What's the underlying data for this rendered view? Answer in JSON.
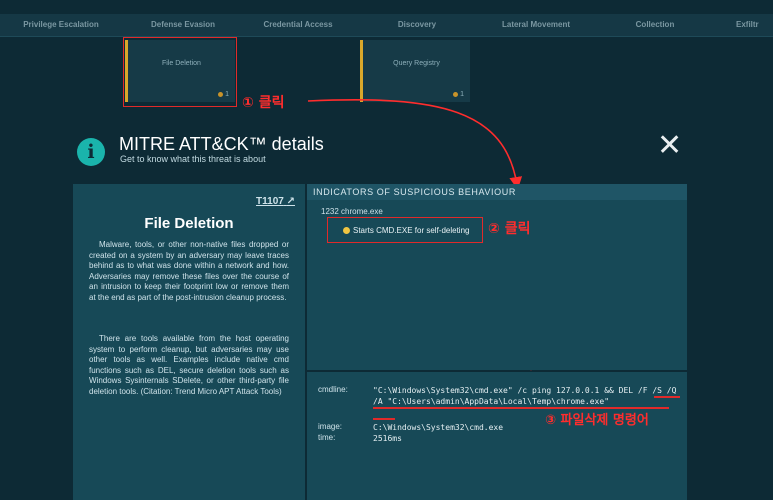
{
  "tactics": [
    "Privilege Escalation",
    "Defense Evasion",
    "Credential Access",
    "Discovery",
    "Lateral Movement",
    "Collection",
    "Exfiltr"
  ],
  "cards": [
    {
      "name": "File Deletion",
      "count": "1"
    },
    {
      "name": "Query Registry",
      "count": "1"
    }
  ],
  "annotations": {
    "step1": "① 클릭",
    "step2": "② 클릭",
    "step3": "③ 파일삭제 명령어"
  },
  "modal": {
    "title": "MITRE ATT&CK™ details",
    "subtitle": "Get to know what this threat is about",
    "info_glyph": "i",
    "close_glyph": "✕"
  },
  "technique": {
    "id": "T1107",
    "title": "File Deletion",
    "para1": "Malware, tools, or other non-native files dropped or created on a system by an adversary may leave traces behind as to what was done within a network and how. Adversaries may remove these files over the course of an intrusion to keep their footprint low or remove them at the end as part of the post-intrusion cleanup process.",
    "para2": "There are tools available from the host operating system to perform cleanup, but adversaries may use other tools as well. Examples include native cmd functions such as DEL, secure deletion tools such as Windows Sysinternals SDelete, or other third-party file deletion tools. (Citation: Trend Micro APT Attack Tools)"
  },
  "indicators": {
    "header": "INDICATORS OF SUSPICIOUS BEHAVIOUR",
    "process": "1232  chrome.exe",
    "item": "Starts CMD.EXE for self-deleting"
  },
  "details": {
    "cmdline_label": "cmdline:",
    "cmdline_value": "\"C:\\Windows\\System32\\cmd.exe\" /c ping 127.0.0.1 && DEL /F /S /Q /A \"C:\\Users\\admin\\AppData\\Local\\Temp\\chrome.exe\"",
    "image_label": "image:",
    "image_value": "C:\\Windows\\System32\\cmd.exe",
    "time_label": "time:",
    "time_value": "2516ms"
  },
  "colors": {
    "annotation": "#ff2d2d",
    "accent": "#1ab4ac",
    "indicator_dot": "#f0c542",
    "card_border": "#d9a82b"
  }
}
